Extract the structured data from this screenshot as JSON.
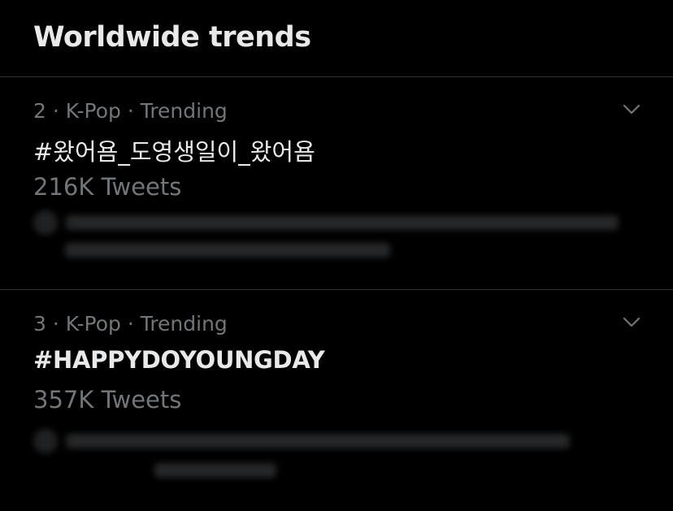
{
  "header": {
    "title": "Worldwide trends"
  },
  "trends": [
    {
      "meta": "2 · K-Pop · Trending",
      "name": "#왔어욤_도영생일이_왔어욤",
      "count": "216K Tweets"
    },
    {
      "meta": "3 · K-Pop · Trending",
      "name": "#HAPPYDOYOUNGDAY",
      "count": "357K Tweets"
    }
  ],
  "icons": {
    "caret": "chevron-down-icon"
  },
  "colors": {
    "background": "#000000",
    "primary_text": "#e7e9ea",
    "secondary_text": "#71767b",
    "divider": "#2f3336"
  }
}
